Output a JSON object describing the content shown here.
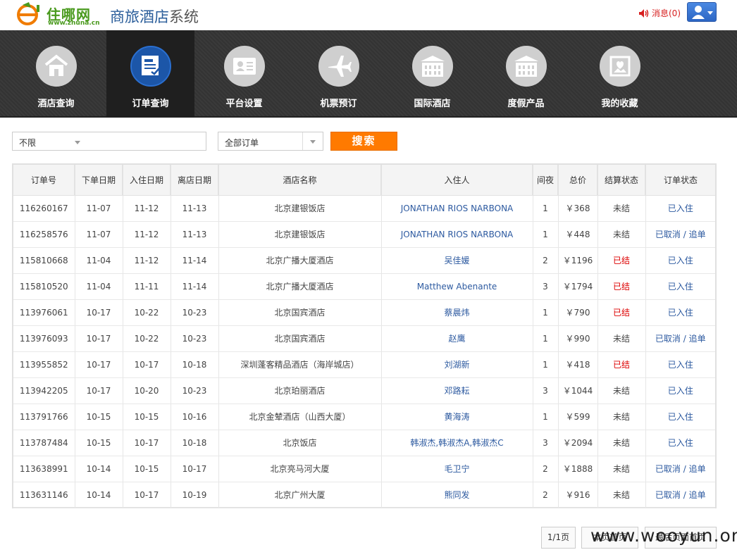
{
  "header": {
    "logo_cn": "住哪网",
    "logo_url": "www.zhuna.cn",
    "title_main": "商旅酒店",
    "title_suffix": "系统",
    "messages_label": "消息(0)"
  },
  "nav": [
    {
      "label": "酒店查询",
      "icon": "house-icon",
      "active": false
    },
    {
      "label": "订单查询",
      "icon": "order-document-icon",
      "active": true
    },
    {
      "label": "平台设置",
      "icon": "id-card-icon",
      "active": false
    },
    {
      "label": "机票预订",
      "icon": "airplane-icon",
      "active": false
    },
    {
      "label": "国际酒店",
      "icon": "building-icon",
      "active": false
    },
    {
      "label": "度假产品",
      "icon": "building-icon",
      "active": false
    },
    {
      "label": "我的收藏",
      "icon": "favorite-picture-icon",
      "active": false
    }
  ],
  "filters": {
    "type_value": "不限",
    "status_value": "全部订单",
    "search_label": "搜索"
  },
  "table": {
    "headers": [
      "订单号",
      "下单日期",
      "入住日期",
      "离店日期",
      "酒店名称",
      "入住人",
      "间夜",
      "总价",
      "结算状态",
      "订单状态"
    ],
    "rows": [
      {
        "order_no": "116260167",
        "order_date": "11-07",
        "checkin": "11-12",
        "checkout": "11-13",
        "hotel": "北京建银饭店",
        "guest": "JONATHAN RIOS NARBONA",
        "nights": "1",
        "price": "￥368",
        "settle": "未结",
        "status": "已入住"
      },
      {
        "order_no": "116258576",
        "order_date": "11-07",
        "checkin": "11-12",
        "checkout": "11-13",
        "hotel": "北京建银饭店",
        "guest": "JONATHAN RIOS NARBONA",
        "nights": "1",
        "price": "￥448",
        "settle": "未结",
        "status": "已取消 / 追单"
      },
      {
        "order_no": "115810668",
        "order_date": "11-04",
        "checkin": "11-12",
        "checkout": "11-14",
        "hotel": "北京广播大厦酒店",
        "guest": "吴佳媛",
        "nights": "2",
        "price": "￥1196",
        "settle": "已结",
        "status": "已入住"
      },
      {
        "order_no": "115810520",
        "order_date": "11-04",
        "checkin": "11-11",
        "checkout": "11-14",
        "hotel": "北京广播大厦酒店",
        "guest": "Matthew Abenante",
        "nights": "3",
        "price": "￥1794",
        "settle": "已结",
        "status": "已入住"
      },
      {
        "order_no": "113976061",
        "order_date": "10-17",
        "checkin": "10-22",
        "checkout": "10-23",
        "hotel": "北京国宾酒店",
        "guest": "蔡晨炜",
        "nights": "1",
        "price": "￥790",
        "settle": "已结",
        "status": "已入住"
      },
      {
        "order_no": "113976093",
        "order_date": "10-17",
        "checkin": "10-22",
        "checkout": "10-23",
        "hotel": "北京国宾酒店",
        "guest": "赵鹰",
        "nights": "1",
        "price": "￥990",
        "settle": "未结",
        "status": "已取消 / 追单"
      },
      {
        "order_no": "113955852",
        "order_date": "10-17",
        "checkin": "10-17",
        "checkout": "10-18",
        "hotel": "深圳蓬客精品酒店（海岸城店）",
        "guest": "刘湖新",
        "nights": "1",
        "price": "￥418",
        "settle": "已结",
        "status": "已入住"
      },
      {
        "order_no": "113942205",
        "order_date": "10-17",
        "checkin": "10-20",
        "checkout": "10-23",
        "hotel": "北京珀丽酒店",
        "guest": "邓路耘",
        "nights": "3",
        "price": "￥1044",
        "settle": "未结",
        "status": "已入住"
      },
      {
        "order_no": "113791766",
        "order_date": "10-15",
        "checkin": "10-15",
        "checkout": "10-16",
        "hotel": "北京金辇酒店（山西大厦）",
        "guest": "黄海涛",
        "nights": "1",
        "price": "￥599",
        "settle": "未结",
        "status": "已入住"
      },
      {
        "order_no": "113787484",
        "order_date": "10-15",
        "checkin": "10-17",
        "checkout": "10-18",
        "hotel": "北京饭店",
        "guest": "韩淑杰,韩淑杰A,韩淑杰C",
        "nights": "3",
        "price": "￥2094",
        "settle": "未结",
        "status": "已入住"
      },
      {
        "order_no": "113638991",
        "order_date": "10-14",
        "checkin": "10-15",
        "checkout": "10-17",
        "hotel": "北京亮马河大厦",
        "guest": "毛卫宁",
        "nights": "2",
        "price": "￥1888",
        "settle": "未结",
        "status": "已取消 / 追单"
      },
      {
        "order_no": "113631146",
        "order_date": "10-14",
        "checkin": "10-17",
        "checkout": "10-19",
        "hotel": "北京广州大厦",
        "guest": "熊同发",
        "nights": "2",
        "price": "￥916",
        "settle": "未结",
        "status": "已取消 / 追单"
      }
    ]
  },
  "pagination": {
    "page_info": "1/1页",
    "prev_label": "本页首页",
    "next_label": "最后页面首页"
  },
  "watermark": "www.wooyun.org",
  "colors": {
    "accent_orange": "#ff7a00",
    "nav_active_blue": "#1c56a8",
    "settled_red": "#dd0000",
    "link_blue": "#2d5aa0",
    "brand_green": "#4a9a1e"
  }
}
